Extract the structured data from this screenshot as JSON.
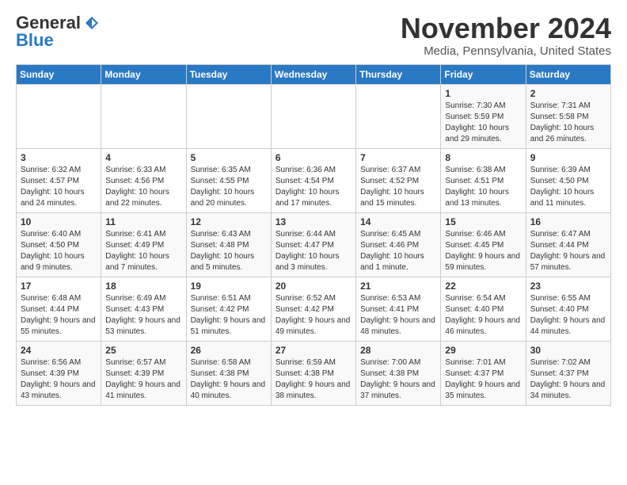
{
  "header": {
    "logo_line1": "General",
    "logo_line2": "Blue",
    "month_title": "November 2024",
    "location": "Media, Pennsylvania, United States"
  },
  "weekdays": [
    "Sunday",
    "Monday",
    "Tuesday",
    "Wednesday",
    "Thursday",
    "Friday",
    "Saturday"
  ],
  "weeks": [
    [
      {
        "day": "",
        "info": ""
      },
      {
        "day": "",
        "info": ""
      },
      {
        "day": "",
        "info": ""
      },
      {
        "day": "",
        "info": ""
      },
      {
        "day": "",
        "info": ""
      },
      {
        "day": "1",
        "info": "Sunrise: 7:30 AM\nSunset: 5:59 PM\nDaylight: 10 hours and 29 minutes."
      },
      {
        "day": "2",
        "info": "Sunrise: 7:31 AM\nSunset: 5:58 PM\nDaylight: 10 hours and 26 minutes."
      }
    ],
    [
      {
        "day": "3",
        "info": "Sunrise: 6:32 AM\nSunset: 4:57 PM\nDaylight: 10 hours and 24 minutes."
      },
      {
        "day": "4",
        "info": "Sunrise: 6:33 AM\nSunset: 4:56 PM\nDaylight: 10 hours and 22 minutes."
      },
      {
        "day": "5",
        "info": "Sunrise: 6:35 AM\nSunset: 4:55 PM\nDaylight: 10 hours and 20 minutes."
      },
      {
        "day": "6",
        "info": "Sunrise: 6:36 AM\nSunset: 4:54 PM\nDaylight: 10 hours and 17 minutes."
      },
      {
        "day": "7",
        "info": "Sunrise: 6:37 AM\nSunset: 4:52 PM\nDaylight: 10 hours and 15 minutes."
      },
      {
        "day": "8",
        "info": "Sunrise: 6:38 AM\nSunset: 4:51 PM\nDaylight: 10 hours and 13 minutes."
      },
      {
        "day": "9",
        "info": "Sunrise: 6:39 AM\nSunset: 4:50 PM\nDaylight: 10 hours and 11 minutes."
      }
    ],
    [
      {
        "day": "10",
        "info": "Sunrise: 6:40 AM\nSunset: 4:50 PM\nDaylight: 10 hours and 9 minutes."
      },
      {
        "day": "11",
        "info": "Sunrise: 6:41 AM\nSunset: 4:49 PM\nDaylight: 10 hours and 7 minutes."
      },
      {
        "day": "12",
        "info": "Sunrise: 6:43 AM\nSunset: 4:48 PM\nDaylight: 10 hours and 5 minutes."
      },
      {
        "day": "13",
        "info": "Sunrise: 6:44 AM\nSunset: 4:47 PM\nDaylight: 10 hours and 3 minutes."
      },
      {
        "day": "14",
        "info": "Sunrise: 6:45 AM\nSunset: 4:46 PM\nDaylight: 10 hours and 1 minute."
      },
      {
        "day": "15",
        "info": "Sunrise: 6:46 AM\nSunset: 4:45 PM\nDaylight: 9 hours and 59 minutes."
      },
      {
        "day": "16",
        "info": "Sunrise: 6:47 AM\nSunset: 4:44 PM\nDaylight: 9 hours and 57 minutes."
      }
    ],
    [
      {
        "day": "17",
        "info": "Sunrise: 6:48 AM\nSunset: 4:44 PM\nDaylight: 9 hours and 55 minutes."
      },
      {
        "day": "18",
        "info": "Sunrise: 6:49 AM\nSunset: 4:43 PM\nDaylight: 9 hours and 53 minutes."
      },
      {
        "day": "19",
        "info": "Sunrise: 6:51 AM\nSunset: 4:42 PM\nDaylight: 9 hours and 51 minutes."
      },
      {
        "day": "20",
        "info": "Sunrise: 6:52 AM\nSunset: 4:42 PM\nDaylight: 9 hours and 49 minutes."
      },
      {
        "day": "21",
        "info": "Sunrise: 6:53 AM\nSunset: 4:41 PM\nDaylight: 9 hours and 48 minutes."
      },
      {
        "day": "22",
        "info": "Sunrise: 6:54 AM\nSunset: 4:40 PM\nDaylight: 9 hours and 46 minutes."
      },
      {
        "day": "23",
        "info": "Sunrise: 6:55 AM\nSunset: 4:40 PM\nDaylight: 9 hours and 44 minutes."
      }
    ],
    [
      {
        "day": "24",
        "info": "Sunrise: 6:56 AM\nSunset: 4:39 PM\nDaylight: 9 hours and 43 minutes."
      },
      {
        "day": "25",
        "info": "Sunrise: 6:57 AM\nSunset: 4:39 PM\nDaylight: 9 hours and 41 minutes."
      },
      {
        "day": "26",
        "info": "Sunrise: 6:58 AM\nSunset: 4:38 PM\nDaylight: 9 hours and 40 minutes."
      },
      {
        "day": "27",
        "info": "Sunrise: 6:59 AM\nSunset: 4:38 PM\nDaylight: 9 hours and 38 minutes."
      },
      {
        "day": "28",
        "info": "Sunrise: 7:00 AM\nSunset: 4:38 PM\nDaylight: 9 hours and 37 minutes."
      },
      {
        "day": "29",
        "info": "Sunrise: 7:01 AM\nSunset: 4:37 PM\nDaylight: 9 hours and 35 minutes."
      },
      {
        "day": "30",
        "info": "Sunrise: 7:02 AM\nSunset: 4:37 PM\nDaylight: 9 hours and 34 minutes."
      }
    ]
  ]
}
